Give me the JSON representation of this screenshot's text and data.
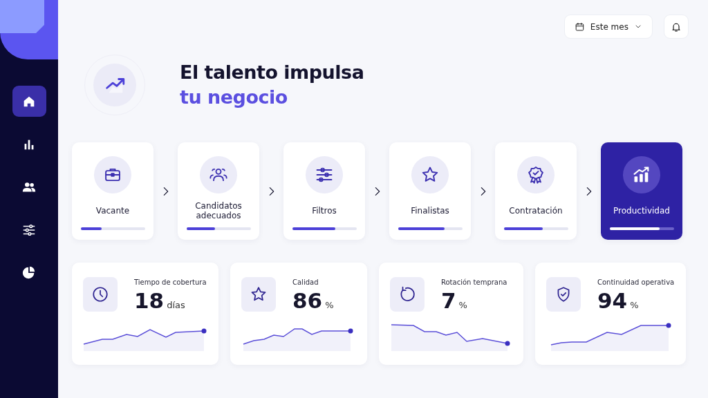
{
  "sidebar": {
    "items": [
      {
        "selected": true
      },
      {
        "selected": false
      },
      {
        "selected": false
      },
      {
        "selected": false
      },
      {
        "selected": false
      }
    ]
  },
  "header": {
    "period": "Este mes"
  },
  "hero": {
    "title": "El talento impulsa",
    "subtitle": "tu negocio"
  },
  "steps": [
    {
      "label": "Vacante",
      "level": 0.33,
      "selected": false
    },
    {
      "label": "Candidatos adecuados",
      "level": 0.45,
      "selected": false
    },
    {
      "label": "Filtros",
      "level": 0.67,
      "selected": false
    },
    {
      "label": "Finalistas",
      "level": 0.73,
      "selected": false
    },
    {
      "label": "Contratación",
      "level": 0.61,
      "selected": false
    },
    {
      "label": "Productividad",
      "level": 0.78,
      "selected": true
    }
  ],
  "metrics": [
    {
      "label": "Tiempo de cobertura",
      "value": "18",
      "unit": "días"
    },
    {
      "label": "Calidad",
      "value": "86",
      "unit": "%"
    },
    {
      "label": "Rotación temprana",
      "value": "7",
      "unit": "%"
    },
    {
      "label": "Continuidad operativa",
      "value": "94",
      "unit": "%"
    }
  ]
}
